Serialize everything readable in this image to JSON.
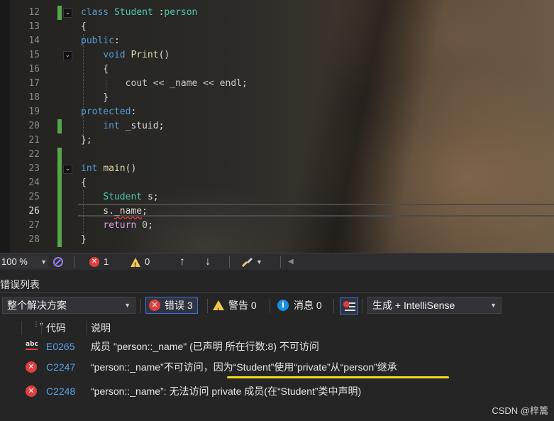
{
  "code": {
    "lines": [
      {
        "num": "12",
        "tokens": [
          {
            "t": "class ",
            "c": "kw"
          },
          {
            "t": "Student",
            "c": "ty"
          },
          {
            "t": " :",
            "c": "pl"
          },
          {
            "t": "person",
            "c": "ty"
          }
        ]
      },
      {
        "num": "13",
        "tokens": [
          {
            "t": "{",
            "c": "pl"
          }
        ]
      },
      {
        "num": "14",
        "tokens": [
          {
            "t": "public",
            "c": "kw"
          },
          {
            "t": ":",
            "c": "pl"
          }
        ]
      },
      {
        "num": "15",
        "tokens": [
          {
            "t": "    ",
            "c": "pl"
          },
          {
            "t": "void ",
            "c": "kw"
          },
          {
            "t": "Print",
            "c": "fn"
          },
          {
            "t": "()",
            "c": "pl"
          }
        ]
      },
      {
        "num": "16",
        "tokens": [
          {
            "t": "    {",
            "c": "pl"
          }
        ]
      },
      {
        "num": "17",
        "tokens": [
          {
            "t": "        cout << _name << endl;",
            "c": "cm"
          }
        ]
      },
      {
        "num": "18",
        "tokens": [
          {
            "t": "    }",
            "c": "pl"
          }
        ]
      },
      {
        "num": "19",
        "tokens": [
          {
            "t": "protected",
            "c": "kw"
          },
          {
            "t": ":",
            "c": "pl"
          }
        ]
      },
      {
        "num": "20",
        "tokens": [
          {
            "t": "    ",
            "c": "pl"
          },
          {
            "t": "int ",
            "c": "kw"
          },
          {
            "t": "_stuid;",
            "c": "id"
          }
        ]
      },
      {
        "num": "21",
        "tokens": [
          {
            "t": "};",
            "c": "pl"
          }
        ]
      },
      {
        "num": "22",
        "tokens": []
      },
      {
        "num": "23",
        "tokens": [
          {
            "t": "int ",
            "c": "kw"
          },
          {
            "t": "main",
            "c": "fn"
          },
          {
            "t": "()",
            "c": "pl"
          }
        ]
      },
      {
        "num": "24",
        "tokens": [
          {
            "t": "{",
            "c": "pl"
          }
        ]
      },
      {
        "num": "25",
        "tokens": [
          {
            "t": "    ",
            "c": "pl"
          },
          {
            "t": "Student ",
            "c": "ty"
          },
          {
            "t": "s;",
            "c": "id"
          }
        ]
      },
      {
        "num": "26",
        "tokens": [
          {
            "t": "    s.",
            "c": "id"
          },
          {
            "t": "_name",
            "c": "id squiggle"
          },
          {
            "t": ";",
            "c": "pl"
          }
        ]
      },
      {
        "num": "27",
        "tokens": [
          {
            "t": "    ",
            "c": "pl"
          },
          {
            "t": "return ",
            "c": "ctl"
          },
          {
            "t": "0",
            "c": "nm"
          },
          {
            "t": ";",
            "c": "pl"
          }
        ]
      },
      {
        "num": "28",
        "tokens": [
          {
            "t": "}",
            "c": "pl"
          }
        ]
      }
    ]
  },
  "statusbar": {
    "zoom": "100 %",
    "error_count": "1",
    "warning_count": "0"
  },
  "error_list": {
    "title": "错误列表",
    "scope": "整个解决方案",
    "errors_button": "错误 3",
    "warnings_button": "警告 0",
    "messages_button": "消息 0",
    "build_filter": "生成 + IntelliSense",
    "col_code": "代码",
    "col_desc": "说明",
    "rows": [
      {
        "icon": "abc",
        "code": "E0265",
        "desc": "成员 \"person::_name\" (已声明 所在行数:8) 不可访问"
      },
      {
        "icon": "error",
        "code": "C2247",
        "desc": "“person::_name”不可访问，因为“Student”使用“private”从“person”继承"
      },
      {
        "icon": "error",
        "code": "C2248",
        "desc": "“person::_name”: 无法访问 private 成员(在“Student”类中声明)"
      }
    ]
  },
  "watermark": "CSDN @梓篙",
  "colors": {
    "highlight": "#f2dc1b",
    "error": "#e13e3e",
    "accent": "#3a6ed8"
  }
}
